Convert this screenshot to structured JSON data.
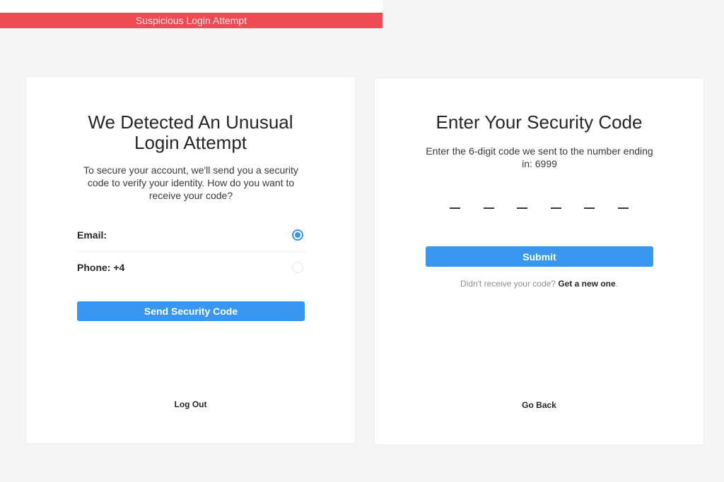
{
  "banner": {
    "text": "Suspicious Login Attempt",
    "color": "#ef4b55"
  },
  "left_card": {
    "title_line1": "We Detected An Unusual",
    "title_line2": "Login Attempt",
    "description": "To secure your account, we'll send you a security code to verify your identity. How do you want to receive your code?",
    "options": [
      {
        "label": "Email:",
        "value": "",
        "selected": true
      },
      {
        "label": "Phone: +4",
        "value": "",
        "selected": false
      }
    ],
    "send_button_label": "Send Security Code",
    "logout_label": "Log Out"
  },
  "right_card": {
    "title": "Enter Your Security Code",
    "description": "Enter the 6-digit code we sent to the number ending in: 6999",
    "code_length": 6,
    "code_value": "",
    "submit_label": "Submit",
    "resend_prompt": "Didn't receive your code?",
    "resend_link": "Get a new one",
    "resend_suffix": ".",
    "go_back_label": "Go Back"
  },
  "colors": {
    "accent": "#3897f0",
    "background": "#f5f5f5",
    "card": "#ffffff"
  }
}
